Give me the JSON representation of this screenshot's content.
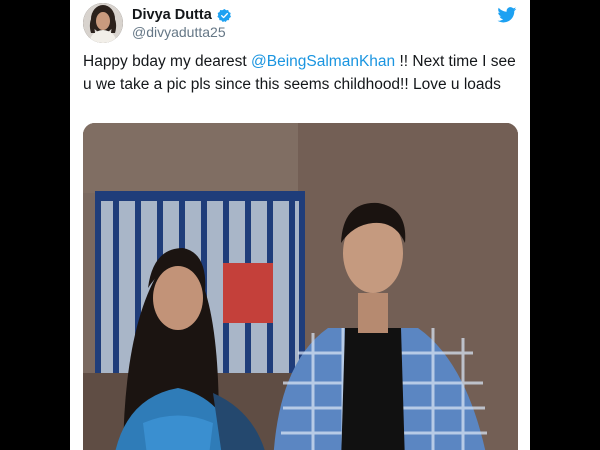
{
  "author": {
    "display_name": "Divya Dutta",
    "handle": "@divyadutta25",
    "verified": true
  },
  "tweet": {
    "text_prefix": "Happy bday my dearest ",
    "mention": "@BeingSalmanKhan",
    "text_suffix": " !! Next time I see u we take a pic pls since this seems childhood!! Love u loads"
  },
  "icons": {
    "brand": "twitter-bird-icon",
    "badge": "verified-badge-icon"
  },
  "colors": {
    "link": "#1b95e0",
    "twitter_blue": "#1da1f2",
    "text": "#14171a",
    "secondary_text": "#657786"
  }
}
